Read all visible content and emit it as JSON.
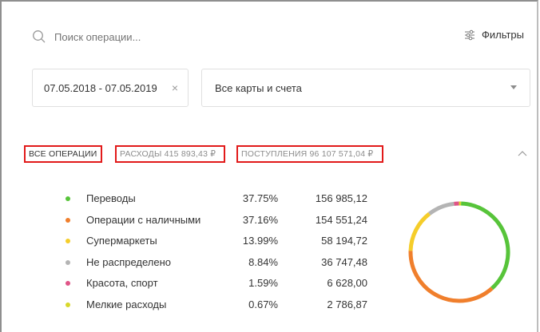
{
  "search": {
    "placeholder": "Поиск операции..."
  },
  "filters": {
    "label": "Фильтры"
  },
  "date_range": {
    "value": "07.05.2018 - 07.05.2019",
    "clear": "×"
  },
  "cards": {
    "value": "Все карты и счета"
  },
  "tabs": {
    "all": "ВСЕ ОПЕРАЦИИ",
    "expenses": "РАСХОДЫ 415 893,43 ₽",
    "income": "ПОСТУПЛЕНИЯ 96 107 571,04 ₽"
  },
  "categories": [
    {
      "name": "Переводы",
      "percent": "37.75%",
      "amount": "156 985,12",
      "color": "#57c43a"
    },
    {
      "name": "Операции с наличными",
      "percent": "37.16%",
      "amount": "154 551,24",
      "color": "#f07f2c"
    },
    {
      "name": "Супермаркеты",
      "percent": "13.99%",
      "amount": "58 194,72",
      "color": "#f5cd2a"
    },
    {
      "name": "Не распределено",
      "percent": "8.84%",
      "amount": "36 747,48",
      "color": "#b4b4b4"
    },
    {
      "name": "Красота, спорт",
      "percent": "1.59%",
      "amount": "6 628,00",
      "color": "#e05587"
    },
    {
      "name": "Мелкие расходы",
      "percent": "0.67%",
      "amount": "2 786,87",
      "color": "#d8d82a"
    }
  ],
  "chart_data": {
    "type": "pie",
    "categories": [
      "Переводы",
      "Операции с наличными",
      "Супермаркеты",
      "Не распределено",
      "Красота, спорт",
      "Мелкие расходы"
    ],
    "values": [
      37.75,
      37.16,
      13.99,
      8.84,
      1.59,
      0.67
    ],
    "colors": [
      "#57c43a",
      "#f07f2c",
      "#f5cd2a",
      "#b4b4b4",
      "#e05587",
      "#d8d82a"
    ]
  }
}
